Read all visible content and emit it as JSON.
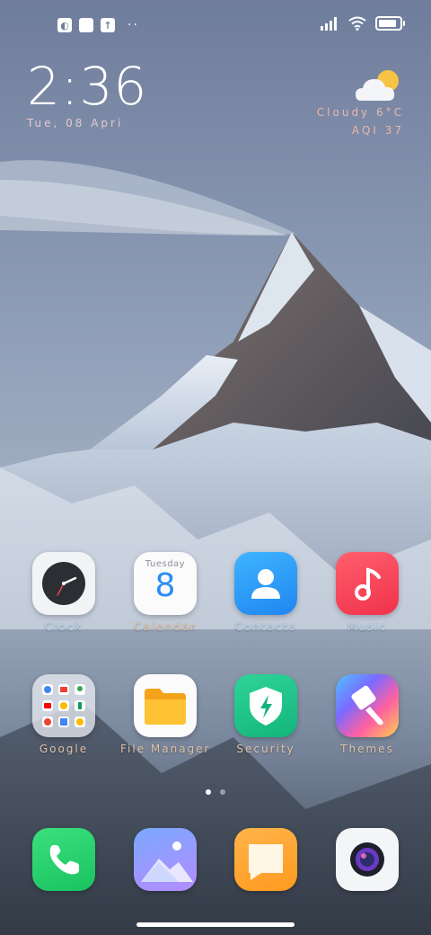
{
  "status_bar": {
    "left_icons": [
      "notification-icon",
      "square-notification-icon",
      "upload-icon"
    ],
    "more": "··",
    "right_icons": [
      "signal-icon",
      "wifi-icon",
      "battery-icon"
    ],
    "battery_level": 0.85
  },
  "clock_widget": {
    "time": "2:36",
    "date": "Tue, 08 Apri"
  },
  "weather": {
    "icon": "partly-cloudy-icon",
    "line1": "Cloudy  6°C",
    "line2": "AQI  37"
  },
  "apps": [
    {
      "label": "Clock",
      "icon": "clock-icon"
    },
    {
      "label": "Calendar",
      "icon": "calendar-icon",
      "day_name": "Tuesday",
      "day_number": "8"
    },
    {
      "label": "Contacts",
      "icon": "contacts-icon"
    },
    {
      "label": "Music",
      "icon": "music-icon"
    },
    {
      "label": "Google",
      "icon": "google-folder-icon"
    },
    {
      "label": "File Manager",
      "icon": "folder-icon"
    },
    {
      "label": "Security",
      "icon": "security-shield-icon"
    },
    {
      "label": "Themes",
      "icon": "paintbrush-icon"
    }
  ],
  "dock": [
    {
      "icon": "phone-icon"
    },
    {
      "icon": "gallery-icon"
    },
    {
      "icon": "notes-icon"
    },
    {
      "icon": "camera-icon"
    }
  ],
  "pages": {
    "count": 2,
    "active": 0
  }
}
